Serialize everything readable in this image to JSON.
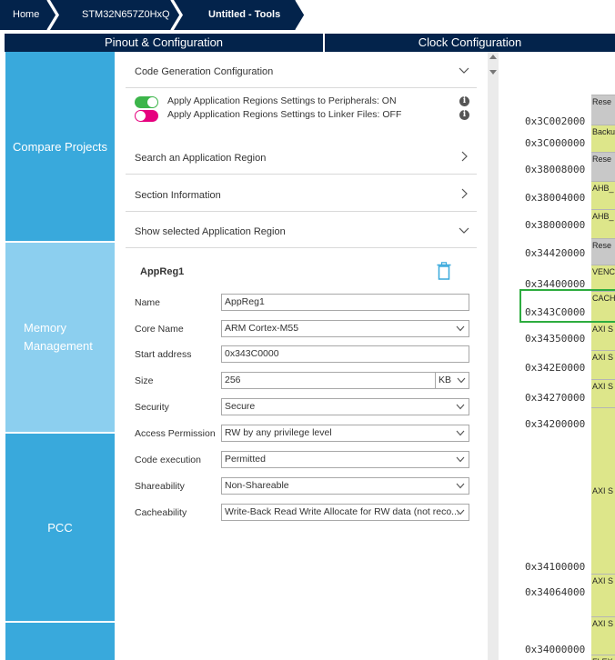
{
  "breadcrumb": {
    "items": [
      "Home",
      "STM32N657Z0HxQ",
      "Untitled - Tools"
    ]
  },
  "tabs": {
    "pinout": "Pinout & Configuration",
    "clock": "Clock Configuration"
  },
  "sidebar": {
    "items": [
      "Compare Projects",
      "Memory",
      "Management",
      "PCC"
    ]
  },
  "panel": {
    "code_gen": "Code Generation Configuration",
    "toggle_peripherals": "Apply Application Regions Settings to Peripherals: ON",
    "toggle_linker": "Apply Application Regions Settings to Linker Files: OFF",
    "search_region": "Search an Application Region",
    "section_info": "Section Information",
    "show_region": "Show selected Application Region"
  },
  "app_region": {
    "title": "AppReg1",
    "fields": {
      "name_label": "Name",
      "name_value": "AppReg1",
      "core_label": "Core Name",
      "core_value": "ARM Cortex-M55",
      "start_label": "Start address",
      "start_value": "0x343C0000",
      "size_label": "Size",
      "size_value": "256",
      "size_unit": "KB",
      "security_label": "Security",
      "security_value": "Secure",
      "access_label": "Access Permission",
      "access_value": "RW by any privilege level",
      "exec_label": "Code execution",
      "exec_value": "Permitted",
      "share_label": "Shareability",
      "share_value": "Non-Shareable",
      "cache_label": "Cacheability",
      "cache_value": "Write-Back Read Write Allocate for RW data (not reco..."
    }
  },
  "memory_map": {
    "addresses": [
      "0x3C002000",
      "0x3C000000",
      "0x38008000",
      "0x38004000",
      "0x38000000",
      "0x34420000",
      "0x34400000",
      "0x343C0000",
      "0x34350000",
      "0x342E0000",
      "0x34270000",
      "0x34200000",
      "0x34100000",
      "0x34064000",
      "0x34000000"
    ],
    "blocks": [
      "Rese",
      "Backu",
      "Rese",
      "AHB_",
      "AHB_",
      "Rese",
      "VENC",
      "CACH",
      "AXI S",
      "AXI S",
      "AXI S",
      "AXI S",
      "AXI S",
      "AXI S",
      "FLEX"
    ],
    "colors": {
      "reserved": "#c8c8c8",
      "region": "#dde68a",
      "highlight": "#2dac3f"
    }
  },
  "colors": {
    "nav": "#03234b",
    "sidebar": "#39a9dc",
    "sidebar_active": "#8ccfef",
    "toggle_on": "#3cb54a",
    "toggle_off": "#e6007e"
  }
}
